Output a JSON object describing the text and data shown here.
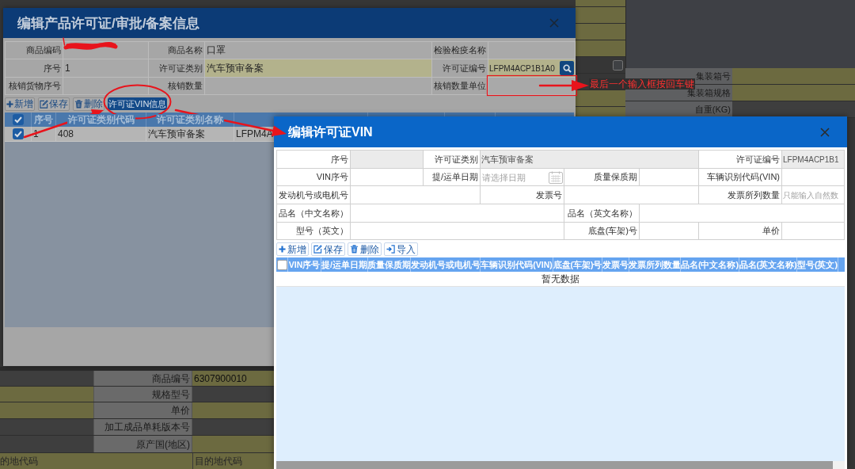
{
  "background_form": {
    "checkbox": {
      "checked": false
    },
    "right_rows": [
      {
        "label": "集装箱号",
        "highlighted": true
      },
      {
        "label": "集装箱规格",
        "highlighted": true
      },
      {
        "label": "自重(KG)",
        "highlighted": false
      }
    ],
    "bottom_rows": [
      {
        "label": "商品编号",
        "value": "6307900010",
        "highlighted": true,
        "left_highlighted": false
      },
      {
        "label": "规格型号",
        "highlighted": false,
        "left_highlighted": true
      },
      {
        "label": "单价",
        "highlighted": true,
        "left_highlighted": true
      },
      {
        "label": "加工成品单耗版本号",
        "highlighted": false,
        "left_highlighted": false
      },
      {
        "label": "原产国(地区)",
        "highlighted": true,
        "left_highlighted": false
      }
    ],
    "last_row": {
      "placeholder_left": "的地代码",
      "placeholder": "目的地代码"
    }
  },
  "product_license_dialog": {
    "title": "编辑产品许可证/审批/备案信息",
    "fields": [
      [
        {
          "label": "商品编码",
          "kind": "text",
          "highlighted": false
        },
        {
          "label": "商品名称",
          "value": "口罩",
          "kind": "text",
          "highlighted": false
        },
        {
          "label": "检验检疫名称",
          "kind": "text",
          "highlighted": false
        }
      ],
      [
        {
          "label": "序号",
          "value": "1",
          "kind": "text",
          "highlighted": false
        },
        {
          "label": "许可证类别",
          "value": "汽车预审备案",
          "kind": "text",
          "highlighted": true
        },
        {
          "label": "许可证编号",
          "value": "LFPM4ACP1B1A0",
          "kind": "lookup",
          "highlighted": true
        }
      ],
      [
        {
          "label": "核销货物序号",
          "kind": "text",
          "highlighted": false
        },
        {
          "label": "核销数量",
          "kind": "text",
          "highlighted": false
        },
        {
          "label": "核销数量单位",
          "kind": "text",
          "highlighted": false
        }
      ]
    ],
    "toolbar": [
      {
        "kind": "add",
        "label": "新增",
        "highlighted": false
      },
      {
        "kind": "edit",
        "label": "保存",
        "highlighted": false
      },
      {
        "kind": "delete",
        "label": "删除",
        "highlighted": false
      },
      {
        "kind": "plain",
        "label": "许可证VIN信息",
        "highlighted": true
      }
    ],
    "table": {
      "all_checked": true,
      "columns": [
        "序号",
        "许可证类别代码",
        "许可证类别名称"
      ],
      "rows": [
        {
          "checked": true,
          "cells": [
            "1",
            "408",
            "汽车预审备案",
            "LFPM4A"
          ]
        }
      ]
    }
  },
  "vin_dialog": {
    "title": "编辑许可证VIN",
    "form": [
      [
        {
          "kind": "label",
          "text": "序号"
        },
        {
          "kind": "input",
          "readonly": true
        },
        {
          "kind": "label",
          "text": "许可证类别"
        },
        {
          "kind": "input",
          "value": "汽车预审备案",
          "readonly": true
        },
        {
          "kind": "label",
          "text": "许可证编号"
        },
        {
          "kind": "input",
          "value": "LFPM4ACP1B1",
          "readonly": true
        }
      ],
      [
        {
          "kind": "label",
          "text": "VIN序号"
        },
        {
          "kind": "input",
          "readonly": false
        },
        {
          "kind": "label",
          "text": "提/运单日期"
        },
        {
          "kind": "date",
          "placeholder": "请选择日期",
          "readonly": false
        },
        {
          "kind": "label",
          "text": "质量保质期"
        },
        {
          "kind": "input",
          "readonly": false
        },
        {
          "kind": "label",
          "text": "车辆识别代码(VIN)"
        },
        {
          "kind": "input",
          "readonly": false
        }
      ],
      [
        {
          "kind": "label",
          "text": "发动机号或电机号"
        },
        {
          "kind": "input",
          "readonly": false
        },
        {
          "kind": "label",
          "text": "发票号"
        },
        {
          "kind": "input",
          "readonly": false
        },
        {
          "kind": "label",
          "text": "发票所列数量"
        },
        {
          "kind": "input",
          "placeholder": "只能输入自然数",
          "readonly": false
        }
      ],
      [
        {
          "kind": "label",
          "text": "品名（中文名称）"
        },
        {
          "kind": "input",
          "readonly": false
        },
        {
          "kind": "label",
          "text": "品名（英文名称）"
        },
        {
          "kind": "input",
          "readonly": false
        }
      ],
      [
        {
          "kind": "label",
          "text": "型号（英文）"
        },
        {
          "kind": "input",
          "readonly": false
        },
        {
          "kind": "label",
          "text": "底盘(车架)号"
        },
        {
          "kind": "input",
          "readonly": false
        },
        {
          "kind": "label",
          "text": "单价"
        },
        {
          "kind": "input",
          "readonly": false
        }
      ]
    ],
    "toolbar": [
      {
        "kind": "add",
        "label": "新增"
      },
      {
        "kind": "edit",
        "label": "保存"
      },
      {
        "kind": "delete",
        "label": "删除"
      },
      {
        "kind": "import",
        "label": "导入"
      }
    ],
    "table": {
      "all_checked": false,
      "columns": [
        "VIN序号",
        "提/运单日期",
        "质量保质期",
        "发动机号或电机号",
        "车辆识别代码(VIN)",
        "底盘(车架)号",
        "发票号",
        "发票所列数量",
        "品名(中文名称)",
        "品名(英文名称)",
        "型号(英文)"
      ],
      "empty_text": "暂无数据"
    }
  },
  "annotation": {
    "note": "最后一个输入框按回车键"
  }
}
